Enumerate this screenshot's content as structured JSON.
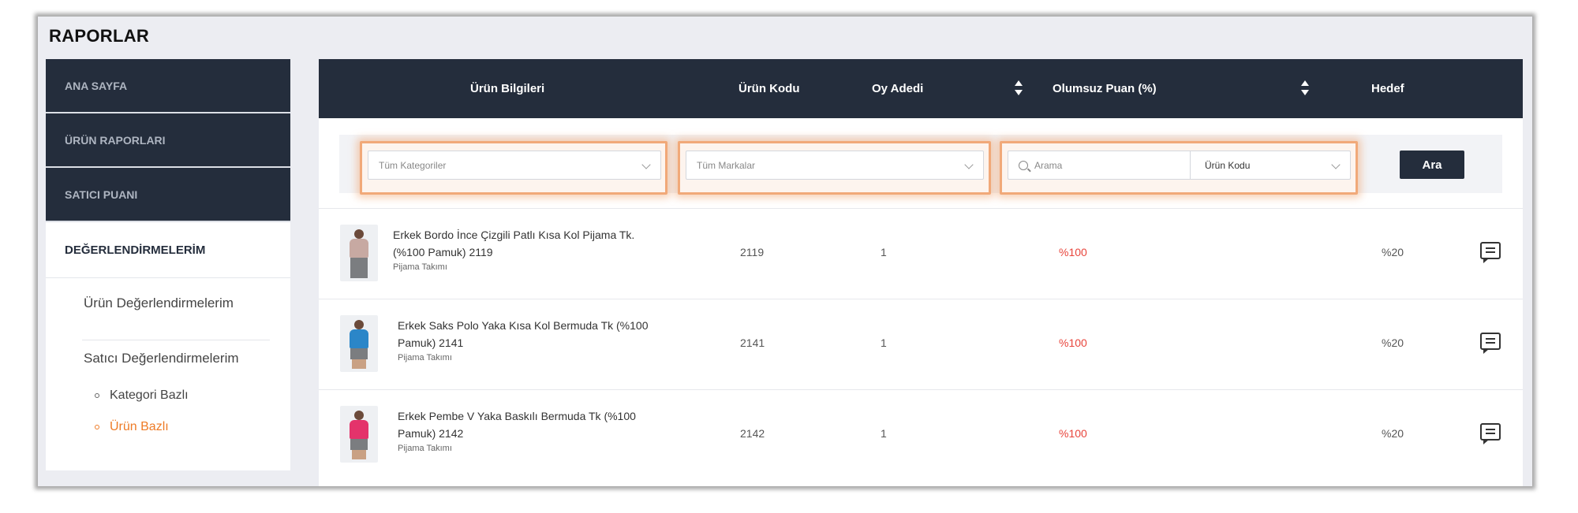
{
  "page_title": "RAPORLAR",
  "sidebar": {
    "items": [
      {
        "label": "ANA SAYFA"
      },
      {
        "label": "ÜRÜN RAPORLARI"
      },
      {
        "label": "SATICI PUANI"
      },
      {
        "label": "DEĞERLENDİRMELERİM"
      }
    ],
    "sub_items": [
      {
        "label": "Ürün Değerlendirmelerim"
      },
      {
        "label": "Satıcı Değerlendirmelerim"
      }
    ],
    "sub_sub_items": [
      {
        "label": "Kategori Bazlı",
        "active": false
      },
      {
        "label": "Ürün Bazlı",
        "active": true
      }
    ],
    "active_color": "#ee7b26"
  },
  "table": {
    "headers": {
      "product_info": "Ürün Bilgileri",
      "product_code": "Ürün Kodu",
      "vote_count": "Oy Adedi",
      "negative_score": "Olumsuz Puan (%)",
      "target": "Hedef"
    },
    "rows": [
      {
        "name": "Erkek Bordo İnce Çizgili Patlı Kısa Kol Pijama Tk. (%100 Pamuk) 2119",
        "category": "Pijama Takımı",
        "code": "2119",
        "votes": "1",
        "negative": "%100",
        "target": "%20",
        "shirt_color": "#c7a9a2"
      },
      {
        "name": "Erkek Saks Polo Yaka Kısa Kol Bermuda Tk (%100 Pamuk) 2141",
        "category": "Pijama Takımı",
        "code": "2141",
        "votes": "1",
        "negative": "%100",
        "target": "%20",
        "shirt_color": "#2b86c8"
      },
      {
        "name": "Erkek Pembe V Yaka Baskılı Bermuda Tk (%100 Pamuk) 2142",
        "category": "Pijama Takımı",
        "code": "2142",
        "votes": "1",
        "negative": "%100",
        "target": "%20",
        "shirt_color": "#e4336b"
      }
    ]
  },
  "filters": {
    "category_placeholder": "Tüm Kategoriler",
    "brand_placeholder": "Tüm Markalar",
    "search_placeholder": "Arama",
    "search_type": "Ürün Kodu",
    "search_button": "Ara"
  },
  "colors": {
    "dark": "#242d3c",
    "highlight": "#f1a979",
    "negative": "#e8453c"
  }
}
